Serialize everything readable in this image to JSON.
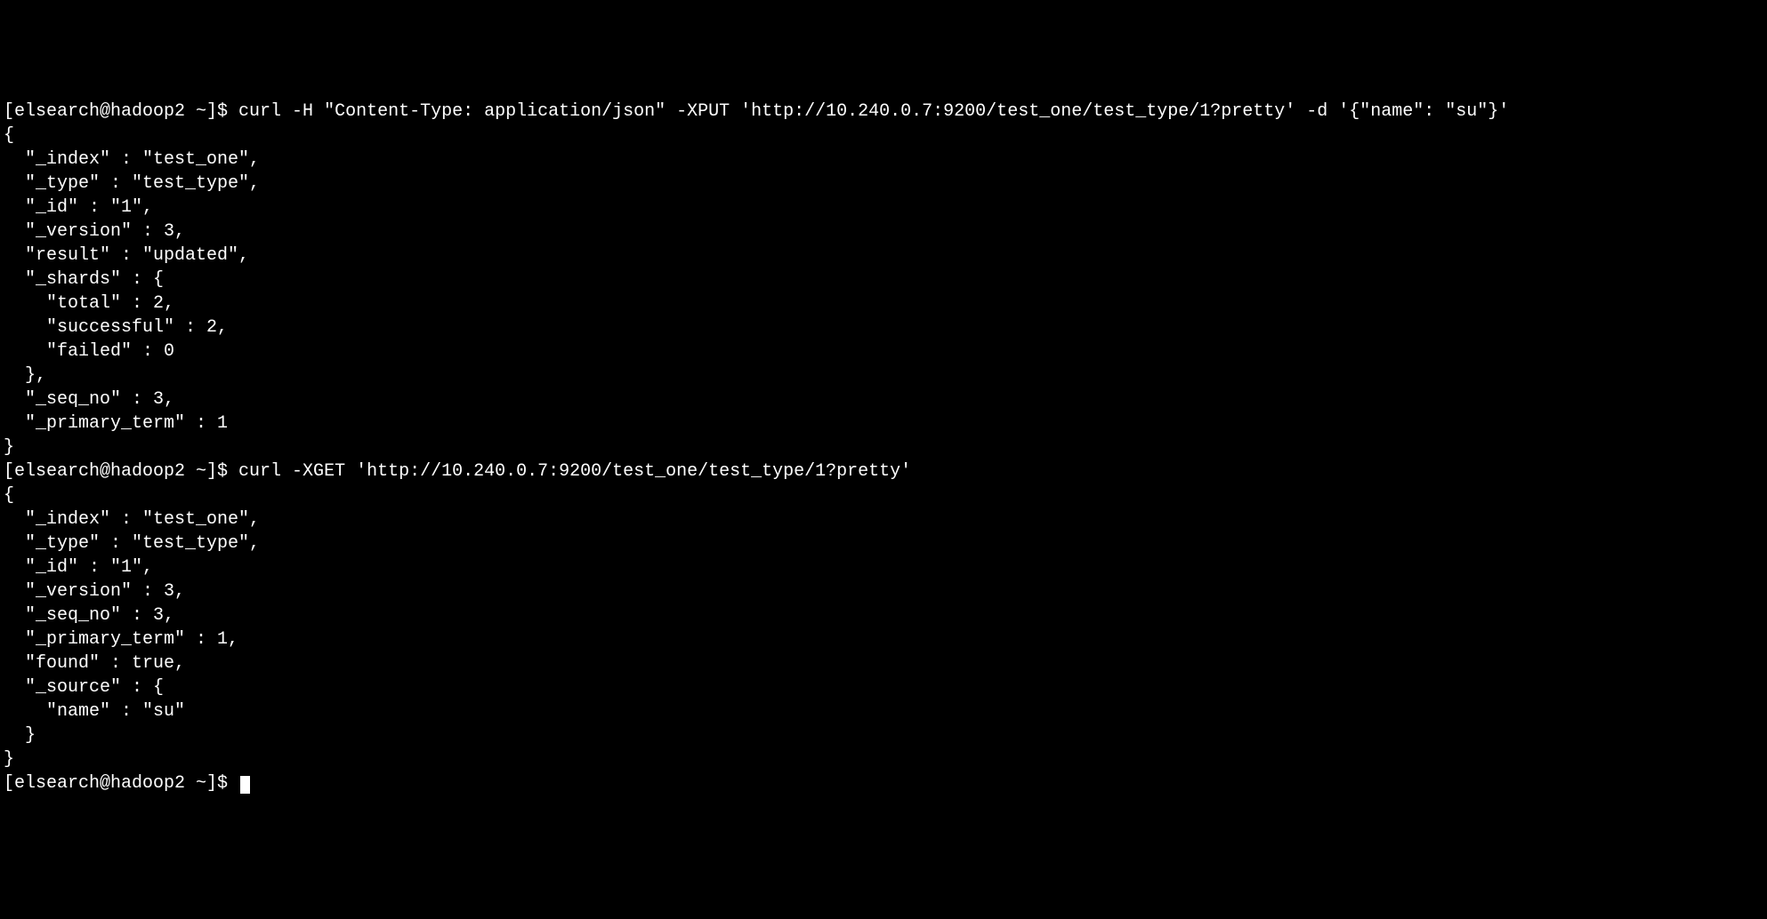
{
  "terminal": {
    "prompt1": "[elsearch@hadoop2 ~]$ ",
    "command1": "curl -H \"Content-Type: application/json\" -XPUT 'http://10.240.0.7:9200/test_one/test_type/1?pretty' -d '{\"name\": \"su\"}'",
    "response1": {
      "line1": "{",
      "line2": "  \"_index\" : \"test_one\",",
      "line3": "  \"_type\" : \"test_type\",",
      "line4": "  \"_id\" : \"1\",",
      "line5": "  \"_version\" : 3,",
      "line6": "  \"result\" : \"updated\",",
      "line7": "  \"_shards\" : {",
      "line8": "    \"total\" : 2,",
      "line9": "    \"successful\" : 2,",
      "line10": "    \"failed\" : 0",
      "line11": "  },",
      "line12": "  \"_seq_no\" : 3,",
      "line13": "  \"_primary_term\" : 1",
      "line14": "}"
    },
    "prompt2": "[elsearch@hadoop2 ~]$ ",
    "command2": "curl -XGET 'http://10.240.0.7:9200/test_one/test_type/1?pretty'",
    "response2": {
      "line1": "{",
      "line2": "  \"_index\" : \"test_one\",",
      "line3": "  \"_type\" : \"test_type\",",
      "line4": "  \"_id\" : \"1\",",
      "line5": "  \"_version\" : 3,",
      "line6": "  \"_seq_no\" : 3,",
      "line7": "  \"_primary_term\" : 1,",
      "line8": "  \"found\" : true,",
      "line9": "  \"_source\" : {",
      "line10": "    \"name\" : \"su\"",
      "line11": "  }",
      "line12": "}"
    },
    "prompt3": "[elsearch@hadoop2 ~]$ "
  }
}
